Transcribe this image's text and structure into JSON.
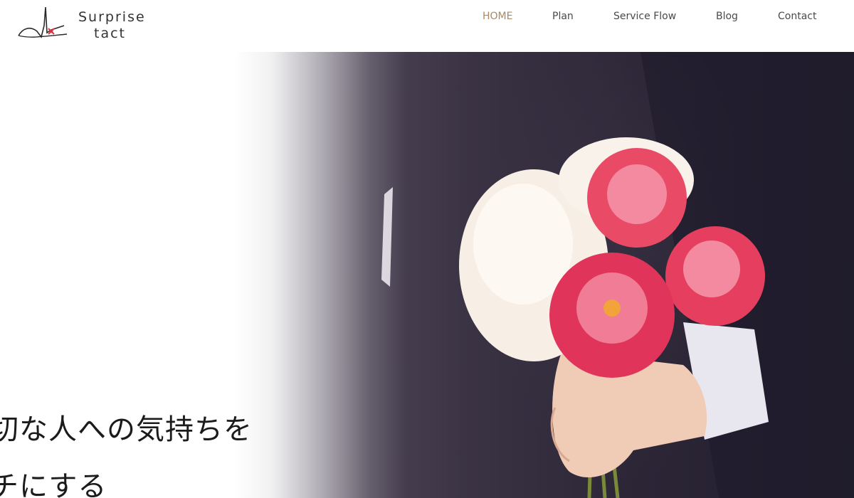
{
  "brand": {
    "line1": "Surprise",
    "line2": "tact",
    "accent_color": "#d9343f"
  },
  "nav": {
    "items": [
      {
        "label": "HOME",
        "active": true
      },
      {
        "label": "Plan",
        "active": false
      },
      {
        "label": "Service Flow",
        "active": false
      },
      {
        "label": "Blog",
        "active": false
      },
      {
        "label": "Contact",
        "active": false
      }
    ],
    "active_color": "#a88964"
  },
  "hero": {
    "tagline": [
      "切な人への気持ちを",
      "チにする"
    ]
  }
}
